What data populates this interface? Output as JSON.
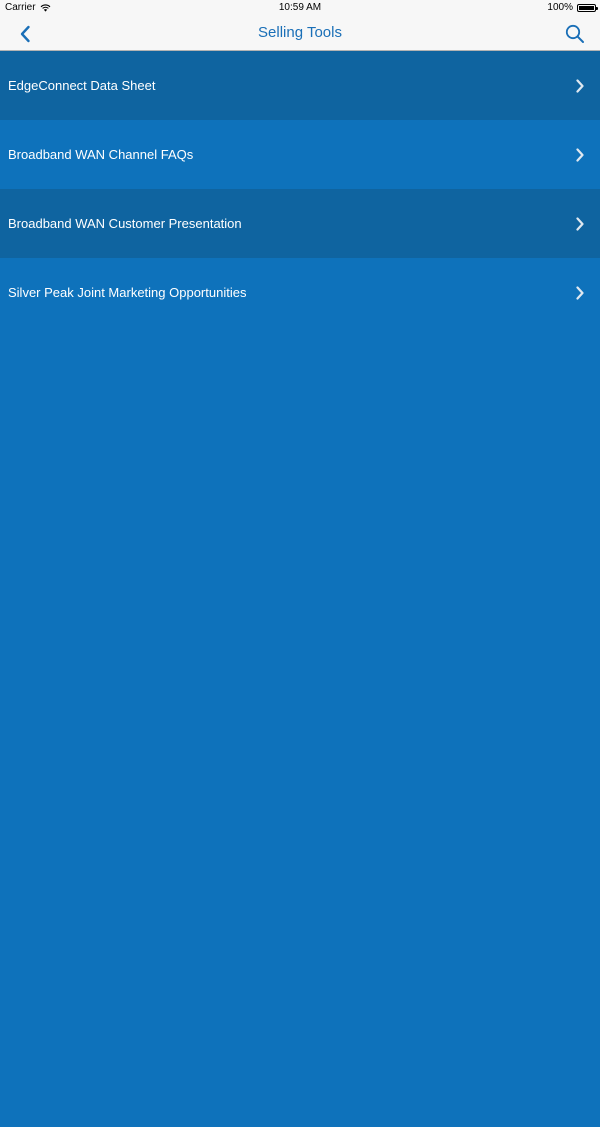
{
  "status_bar": {
    "carrier": "Carrier",
    "time": "10:59 AM",
    "battery_percent": "100%"
  },
  "nav": {
    "title": "Selling Tools",
    "back_icon": "chevron-left-icon",
    "search_icon": "search-icon",
    "accent_color": "#1a6fb7"
  },
  "list": {
    "items": [
      {
        "label": "EdgeConnect Data Sheet"
      },
      {
        "label": "Broadband WAN Channel FAQs"
      },
      {
        "label": "Broadband WAN Customer Presentation"
      },
      {
        "label": "Silver Peak Joint Marketing Opportunities"
      }
    ],
    "row_colors": {
      "dark": "#0f64a0",
      "light": "#0e72bb"
    },
    "chevron_icon": "chevron-right-icon"
  }
}
